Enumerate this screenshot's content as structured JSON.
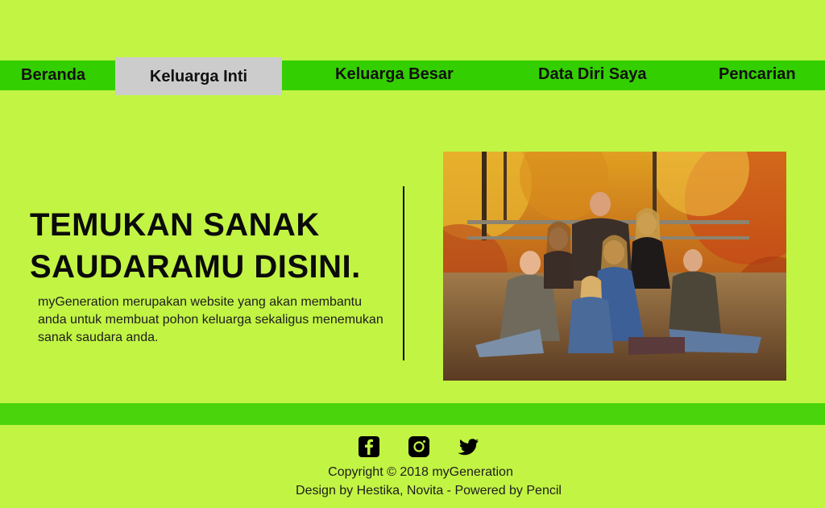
{
  "nav": {
    "items": [
      {
        "label": "Beranda"
      },
      {
        "label": "Keluarga Inti",
        "active": true
      },
      {
        "label": "Keluarga Besar"
      },
      {
        "label": "Data Diri Saya"
      },
      {
        "label": "Pencarian"
      }
    ]
  },
  "hero": {
    "title_line1": "TEMUKAN SANAK",
    "title_line2": "SAUDARAMU DISINI.",
    "description": "myGeneration merupakan website yang akan membantu anda untuk membuat pohon keluarga sekaligus menemukan sanak saudara anda."
  },
  "image": {
    "subject": "family photo in autumn forest"
  },
  "footer": {
    "social_icons": [
      "facebook-icon",
      "instagram-icon",
      "twitter-icon"
    ],
    "copyright": "Copyright © 2018 myGeneration",
    "credits": "Design by Hestika, Novita - Powered by Pencil"
  },
  "colors": {
    "background": "#c2f444",
    "nav_bar": "#34cf00",
    "nav_active": "#cccccc",
    "footer_bar": "#4ad40c"
  }
}
